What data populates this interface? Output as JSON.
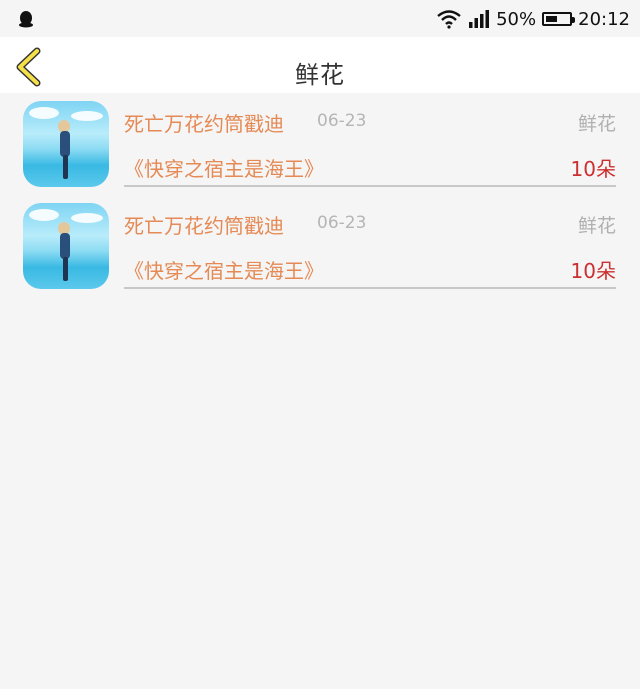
{
  "status_bar": {
    "notification_icon": "qq-penguin-icon",
    "wifi_icon": "wifi-icon",
    "signal_icon": "signal-icon",
    "battery_percent": "50%",
    "battery_level": 0.5,
    "time": "20:12"
  },
  "header": {
    "back_icon": "chevron-left-icon",
    "title": "鲜花"
  },
  "records": [
    {
      "sender": "死亡万花约筒戳迪",
      "date": "06-23",
      "gift_type": "鲜花",
      "book": "《快穿之宿主是海王》",
      "amount": "10朵"
    },
    {
      "sender": "死亡万花约筒戳迪",
      "date": "06-23",
      "gift_type": "鲜花",
      "book": "《快穿之宿主是海王》",
      "amount": "10朵"
    }
  ],
  "colors": {
    "accent_orange": "#e58a55",
    "count_red": "#cc2f2f",
    "back_arrow_yellow": "#f5e04a"
  }
}
